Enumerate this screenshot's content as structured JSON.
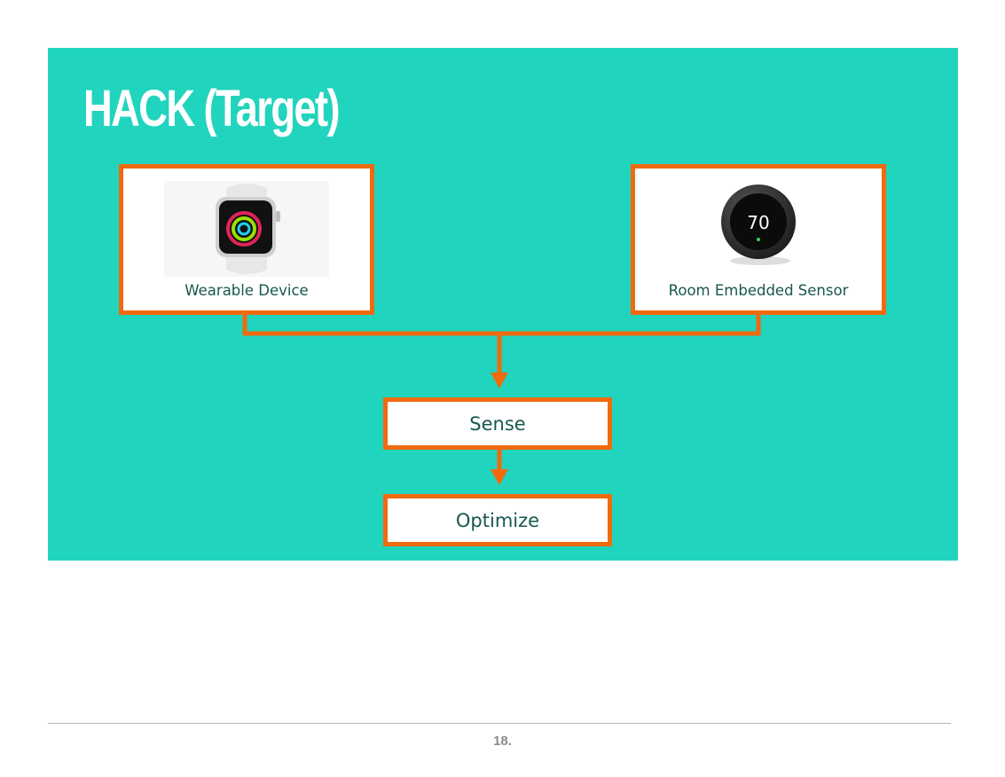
{
  "slide": {
    "title": "HACK (Target)",
    "background_color": "#21d4bd",
    "accent_color": "#f06a0f",
    "label_color": "#17584f"
  },
  "diagram": {
    "sources": [
      {
        "label": "Wearable Device",
        "icon": "smartwatch-icon"
      },
      {
        "label": "Room Embedded Sensor",
        "icon": "thermostat-icon",
        "display_value": "70"
      }
    ],
    "steps": [
      {
        "label": "Sense"
      },
      {
        "label": "Optimize"
      }
    ]
  },
  "footer": {
    "page_number": "18."
  }
}
